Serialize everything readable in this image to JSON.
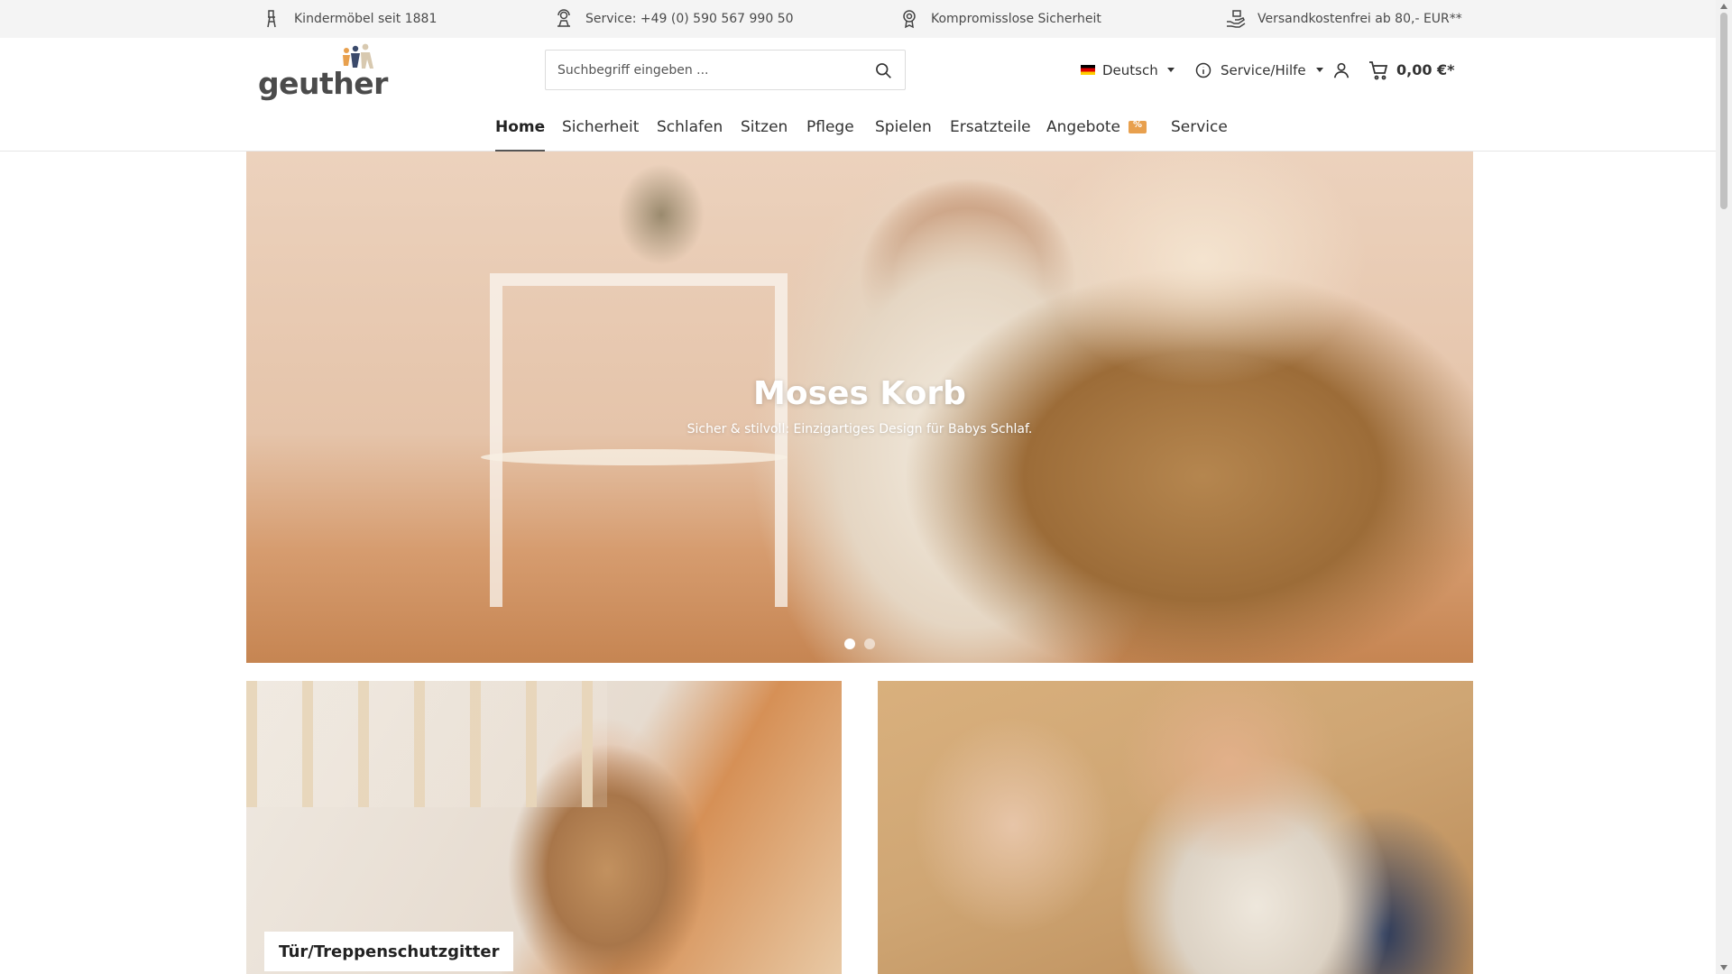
{
  "topbar": {
    "items": [
      {
        "icon": "highchair-icon",
        "label": "Kindermöbel seit 1881"
      },
      {
        "icon": "support-agent-icon",
        "label": "Service: +49 (0) 590 567 990 50"
      },
      {
        "icon": "award-icon",
        "label": "Kompromisslose Sicherheit"
      },
      {
        "icon": "delivery-hand-icon",
        "label": "Versandkostenfrei ab 80,- EUR**"
      }
    ]
  },
  "header": {
    "logo_text": "geuther",
    "search": {
      "placeholder": "Suchbegriff eingeben ..."
    },
    "language": {
      "label": "Deutsch",
      "flag": "de-flag-icon"
    },
    "service": {
      "label": "Service/Hilfe"
    },
    "cart": {
      "total": "0,00 €*"
    }
  },
  "nav": {
    "items": [
      "Home",
      "Sicherheit",
      "Schlafen",
      "Sitzen",
      "Pflege",
      "Spielen",
      "Ersatzteile",
      "Angebote",
      "Service"
    ],
    "active": "Home"
  },
  "hero": {
    "title": "Moses Korb",
    "subtitle": "Sicher & stilvoll: Einzigartiges Design für Babys Schlaf.",
    "slide_count": 2,
    "active_slide": 1
  },
  "tiles": [
    {
      "label": "Tür/Treppenschutzgitter"
    },
    {
      "label": ""
    }
  ],
  "colors": {
    "accent_sale": "#e8a04e",
    "text": "#222222",
    "topbar_bg": "#f4f4f4"
  }
}
